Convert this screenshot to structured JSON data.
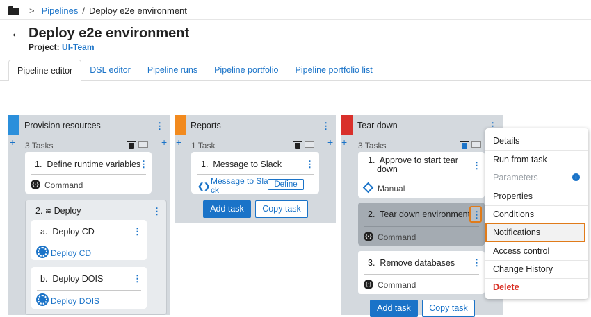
{
  "breadcrumb": {
    "root": "Pipelines",
    "current": "Deploy e2e environment"
  },
  "header": {
    "title": "Deploy e2e environment",
    "project_label": "Project:",
    "project_value": "UI-Team"
  },
  "tabs": [
    {
      "label": "Pipeline editor",
      "active": true
    },
    {
      "label": "DSL editor"
    },
    {
      "label": "Pipeline runs"
    },
    {
      "label": "Pipeline portfolio"
    },
    {
      "label": "Pipeline portfolio list"
    }
  ],
  "stages": [
    {
      "name": "Provision resources",
      "color": "#2b8fdb",
      "tasks_count": "3 Tasks",
      "tasks": [
        {
          "num": "1.",
          "name": "Define runtime variables",
          "type": "Command"
        },
        {
          "num": "2.",
          "name": "Deploy",
          "children": [
            {
              "num": "a.",
              "name": "Deploy CD",
              "link": "Deploy CD"
            },
            {
              "num": "b.",
              "name": "Deploy DOIS",
              "link": "Deploy DOIS"
            }
          ]
        }
      ]
    },
    {
      "name": "Reports",
      "color": "#f28a1e",
      "tasks_count": "1 Task",
      "tasks": [
        {
          "num": "1.",
          "name": "Message to Slack",
          "link_line1": "Message to Sla",
          "link_line2": "ck",
          "define_label": "Define"
        }
      ],
      "add_task": "Add task",
      "copy_task": "Copy task"
    },
    {
      "name": "Tear down",
      "color": "#d9302b",
      "tasks_count": "3 Tasks",
      "tasks": [
        {
          "num": "1.",
          "name_line1": "Approve to start tear",
          "name_line2": "down",
          "type": "Manual"
        },
        {
          "num": "2.",
          "name": "Tear down environments",
          "type": "Command"
        },
        {
          "num": "3.",
          "name": "Remove databases",
          "type": "Command"
        }
      ],
      "add_task": "Add task",
      "copy_task": "Copy task"
    }
  ],
  "context_menu": {
    "items": [
      {
        "label": "Details"
      },
      {
        "label": "Run from task"
      },
      {
        "label": "Parameters",
        "disabled": true
      },
      {
        "label": "Properties"
      },
      {
        "label": "Conditions"
      },
      {
        "label": "Notifications",
        "highlighted": true
      },
      {
        "label": "Access control"
      },
      {
        "label": "Change History"
      },
      {
        "label": "Delete",
        "danger": true
      }
    ]
  },
  "colors": {
    "accent": "#1a73c8",
    "highlight": "#e07b1a",
    "danger": "#d93025"
  }
}
